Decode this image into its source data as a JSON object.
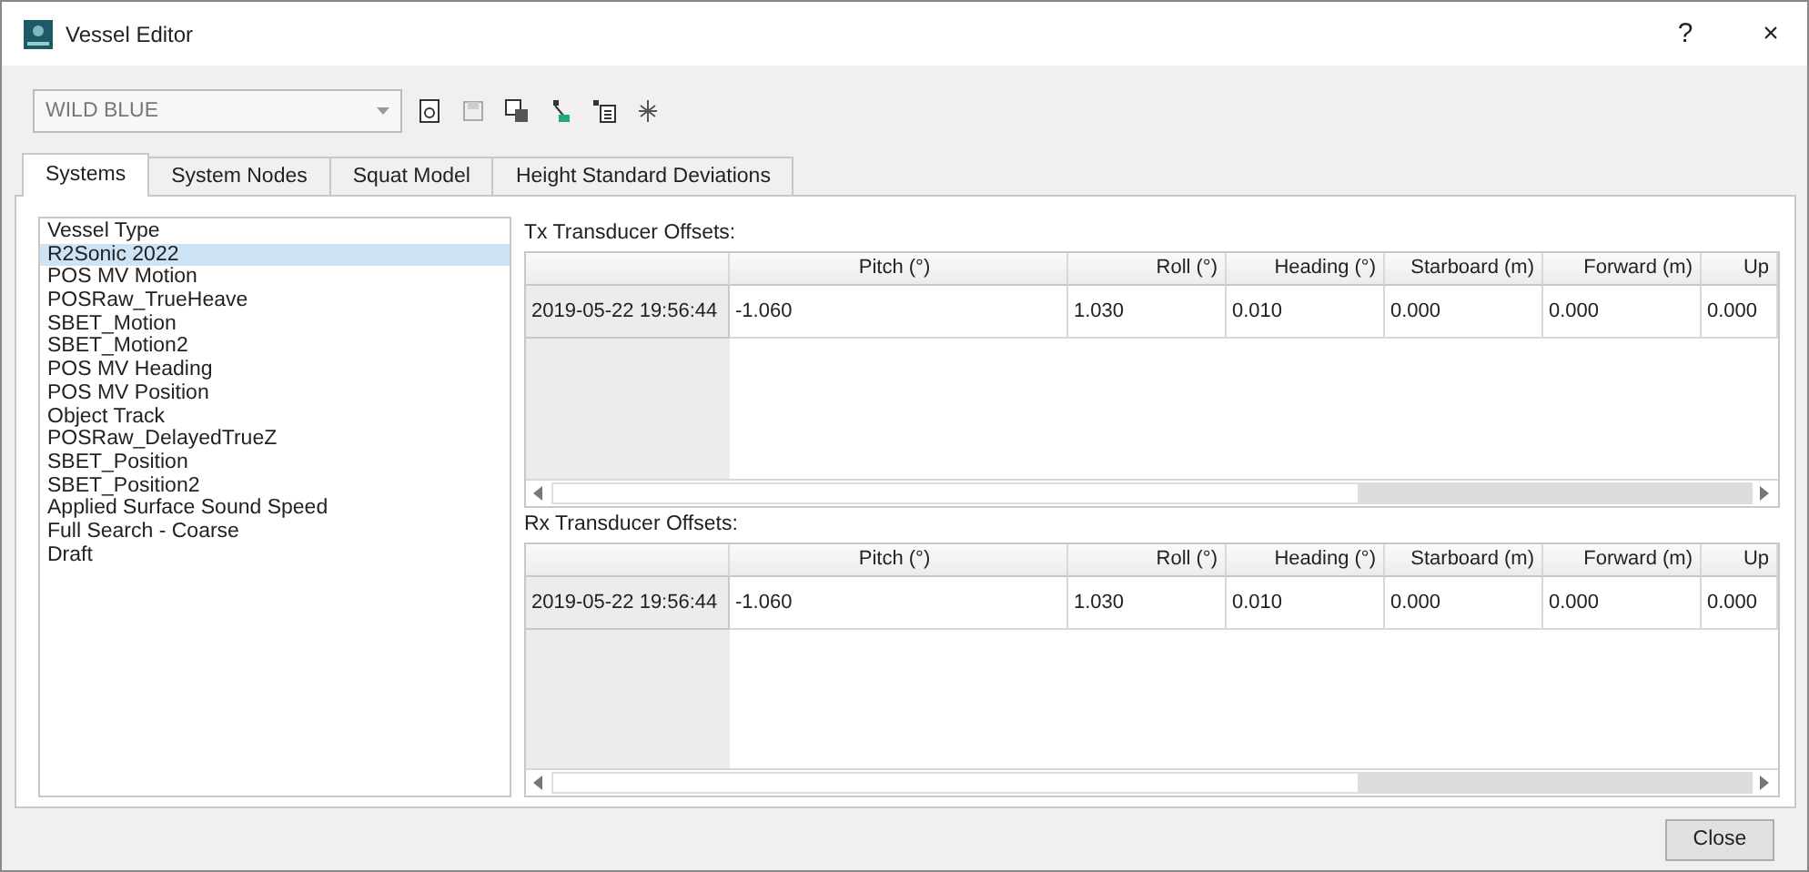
{
  "window": {
    "title": "Vessel Editor",
    "help": "?",
    "close": "×"
  },
  "vessel_selector": {
    "value": "WILD BLUE"
  },
  "tabs": [
    {
      "label": "Systems",
      "selected": true
    },
    {
      "label": "System Nodes",
      "selected": false
    },
    {
      "label": "Squat Model",
      "selected": false
    },
    {
      "label": "Height Standard Deviations",
      "selected": false
    }
  ],
  "systems": [
    {
      "label": "Vessel Type",
      "selected": false
    },
    {
      "label": "R2Sonic 2022",
      "selected": true
    },
    {
      "label": "POS MV Motion",
      "selected": false
    },
    {
      "label": "POSRaw_TrueHeave",
      "selected": false
    },
    {
      "label": "SBET_Motion",
      "selected": false
    },
    {
      "label": "SBET_Motion2",
      "selected": false
    },
    {
      "label": "POS MV Heading",
      "selected": false
    },
    {
      "label": "POS MV Position",
      "selected": false
    },
    {
      "label": "Object Track",
      "selected": false
    },
    {
      "label": "POSRaw_DelayedTrueZ",
      "selected": false
    },
    {
      "label": "SBET_Position",
      "selected": false
    },
    {
      "label": "SBET_Position2",
      "selected": false
    },
    {
      "label": "Applied Surface Sound Speed",
      "selected": false
    },
    {
      "label": "Full Search - Coarse",
      "selected": false
    },
    {
      "label": "Draft",
      "selected": false
    }
  ],
  "tables": [
    {
      "title": "Tx Transducer Offsets:",
      "columns": [
        "Pitch (°)",
        "Roll (°)",
        "Heading (°)",
        "Starboard (m)",
        "Forward (m)",
        "Up"
      ],
      "rows": [
        {
          "time": "2019-05-22 19:56:44",
          "cells": [
            "-1.060",
            "1.030",
            "0.010",
            "0.000",
            "0.000",
            "0.000"
          ]
        }
      ]
    },
    {
      "title": "Rx Transducer Offsets:",
      "columns": [
        "Pitch (°)",
        "Roll (°)",
        "Heading (°)",
        "Starboard (m)",
        "Forward (m)",
        "Up"
      ],
      "rows": [
        {
          "time": "2019-05-22 19:56:44",
          "cells": [
            "-1.060",
            "1.030",
            "0.010",
            "0.000",
            "0.000",
            "0.000"
          ]
        }
      ]
    }
  ],
  "buttons": [
    "Close"
  ]
}
